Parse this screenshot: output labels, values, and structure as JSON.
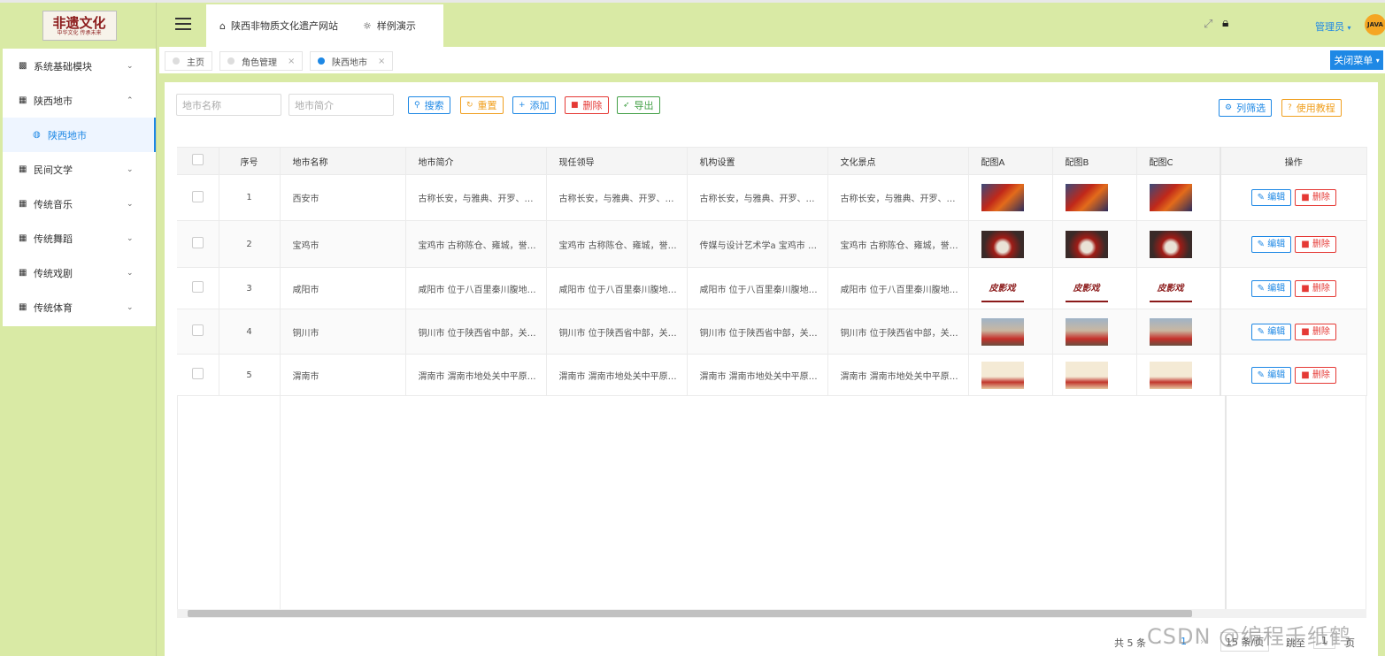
{
  "header": {
    "site_link": "陕西非物质文化遗产网站",
    "demo_link": "样例演示",
    "user": "管理员",
    "avatar_text": "JAVA"
  },
  "logo": {
    "title": "非遗文化",
    "subtitle": "中华文化 传承未来"
  },
  "sidebar": {
    "items": [
      {
        "label": "系统基础模块",
        "icon": "chart-icon",
        "chev": "⌄"
      },
      {
        "label": "陕西地市",
        "icon": "grid-icon",
        "chev": "⌃"
      },
      {
        "label": "陕西地市",
        "icon": "globe-icon",
        "chev": ""
      },
      {
        "label": "民间文学",
        "icon": "grid-icon",
        "chev": "⌄"
      },
      {
        "label": "传统音乐",
        "icon": "grid-icon",
        "chev": "⌄"
      },
      {
        "label": "传统舞蹈",
        "icon": "grid-icon",
        "chev": "⌄"
      },
      {
        "label": "传统戏剧",
        "icon": "grid-icon",
        "chev": "⌄"
      },
      {
        "label": "传统体育",
        "icon": "grid-icon",
        "chev": "⌄"
      }
    ]
  },
  "tabs": {
    "home": "主页",
    "role": "角色管理",
    "city": "陕西地市",
    "close_menu": "关闭菜单"
  },
  "search": {
    "name_placeholder": "地市名称",
    "intro_placeholder": "地市简介",
    "search": "搜索",
    "reset": "重置",
    "add": "添加",
    "delete": "删除",
    "export": "导出",
    "columns": "列筛选",
    "tutorial": "使用教程"
  },
  "table": {
    "headers": [
      "序号",
      "地市名称",
      "地市简介",
      "现任领导",
      "机构设置",
      "文化景点",
      "配图A",
      "配图B",
      "配图C",
      "操作"
    ],
    "edit": "编辑",
    "del": "删除",
    "rows": [
      {
        "no": "1",
        "name": "西安市",
        "intro": "古称长安，与雅典、开罗、…",
        "leader": "古称长安，与雅典、开罗、…",
        "org": "古称长安，与雅典、开罗、…",
        "spot": "古称长安，与雅典、开罗、…"
      },
      {
        "no": "2",
        "name": "宝鸡市",
        "intro": "宝鸡市 古称陈仓、雍城，誉…",
        "leader": "宝鸡市 古称陈仓、雍城，誉…",
        "org": "传媒与设计艺术学a 宝鸡市 …",
        "spot": "宝鸡市 古称陈仓、雍城，誉…"
      },
      {
        "no": "3",
        "name": "咸阳市",
        "intro": "咸阳市 位于八百里秦川腹地…",
        "leader": "咸阳市 位于八百里秦川腹地…",
        "org": "咸阳市 位于八百里秦川腹地…",
        "spot": "咸阳市 位于八百里秦川腹地…"
      },
      {
        "no": "4",
        "name": "铜川市",
        "intro": "铜川市 位于陕西省中部，关…",
        "leader": "铜川市 位于陕西省中部，关…",
        "org": "铜川市 位于陕西省中部，关…",
        "spot": "铜川市 位于陕西省中部，关…"
      },
      {
        "no": "5",
        "name": "渭南市",
        "intro": "渭南市 渭南市地处关中平原…",
        "leader": "渭南市 渭南市地处关中平原…",
        "org": "渭南市 渭南市地处关中平原…",
        "spot": "渭南市 渭南市地处关中平原…"
      }
    ],
    "thumb_text_3": "皮影戏"
  },
  "pager": {
    "total": "共 5 条",
    "page": "1",
    "size": "15 条/页",
    "jump": "跳至",
    "page_input": "1",
    "page_unit": "页"
  },
  "watermark": "CSDN @编程千纸鹤",
  "colors": {
    "primary": "#1e88e5",
    "warning": "#f0a020",
    "danger": "#e53935",
    "success": "#43a047",
    "sidebar_bg": "#d9eaa5"
  }
}
